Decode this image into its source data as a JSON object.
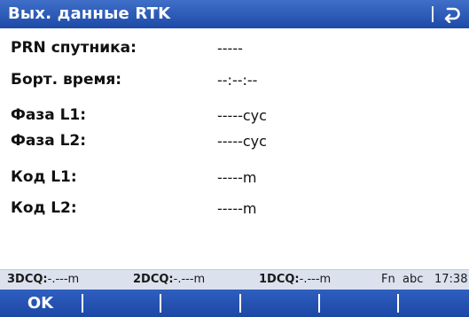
{
  "header": {
    "title": "Вых. данные RTK"
  },
  "fields": [
    {
      "label": "PRN спутника:",
      "value": "-----"
    },
    {
      "label": "Борт. время:",
      "value": "--:--:--"
    },
    {
      "label": "Фаза L1:",
      "value": "-----cyc"
    },
    {
      "label": "Фаза L2:",
      "value": "-----cyc"
    },
    {
      "label": "Код L1:",
      "value": "-----m"
    },
    {
      "label": "Код L2:",
      "value": "-----m"
    }
  ],
  "status": {
    "cq3d_label": "3DCQ:",
    "cq3d_value": "-.---m",
    "cq2d_label": "2DCQ:",
    "cq2d_value": "-.---m",
    "cq1d_label": "1DCQ:",
    "cq1d_value": "-.---m",
    "fn": "Fn",
    "input_mode": "abc",
    "time": "17:38"
  },
  "function_keys": {
    "f1": "OK",
    "f2": "",
    "f3": "",
    "f4": "",
    "f5": "",
    "f6": ""
  },
  "icons": {
    "back": "return-arrow-icon"
  },
  "colors": {
    "title_bar": "#2a5bbf",
    "status_bar": "#dbe2ee",
    "function_bar": "#2553b5"
  }
}
